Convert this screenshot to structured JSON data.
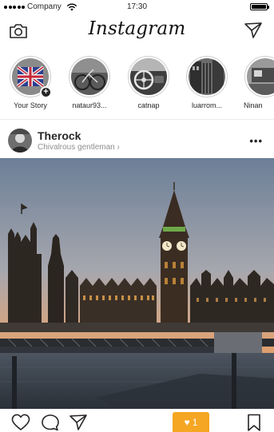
{
  "status_bar": {
    "carrier": "Company",
    "time": "17:30"
  },
  "nav": {
    "app_name": "Instagram"
  },
  "stories": [
    {
      "label": "Your Story",
      "add_badge": "+"
    },
    {
      "label": "nataur93..."
    },
    {
      "label": "catnap"
    },
    {
      "label": "luarrom..."
    },
    {
      "label": "Ninan"
    }
  ],
  "post": {
    "username": "Therock",
    "subtitle": "Chivalrous gentleman",
    "more_label": "•••",
    "likes_count": "1"
  },
  "colors": {
    "likes_badge": "#f5a623",
    "text": "#262626",
    "muted": "#8e8e8e"
  }
}
